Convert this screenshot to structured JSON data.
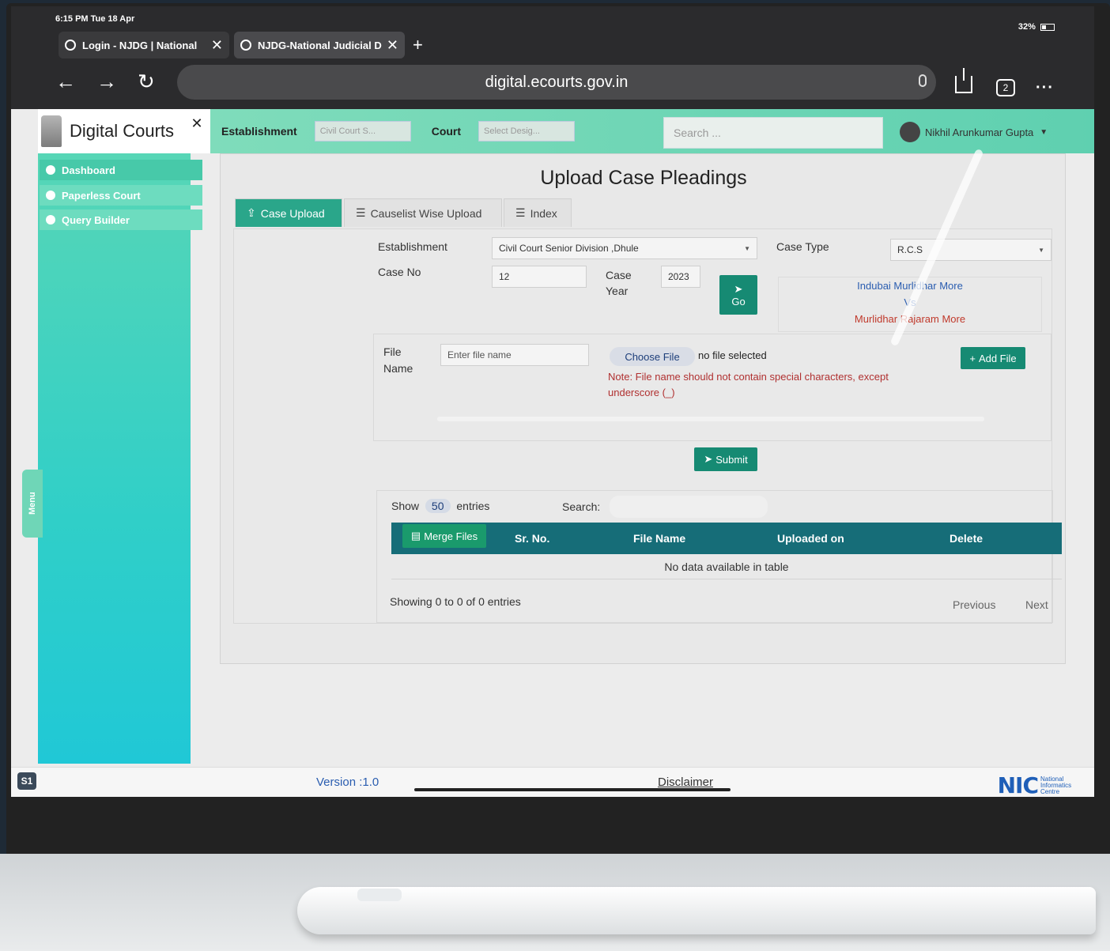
{
  "status_bar": {
    "time": "6:15 PM  Tue 18 Apr",
    "battery": "32%"
  },
  "browser": {
    "tabs": [
      {
        "label": "Login - NJDG | National"
      },
      {
        "label": "NJDG-National Judicial D"
      }
    ],
    "url": "digital.ecourts.gov.in",
    "tab_count": "2"
  },
  "app": {
    "brand": "Digital Courts",
    "header": {
      "establishment_label": "Establishment",
      "establishment_value": "Civil Court S...",
      "court_label": "Court",
      "court_value": "Select Desig...",
      "search_placeholder": "Search ...",
      "user_name": "Nikhil Arunkumar Gupta"
    },
    "sidebar": {
      "items": [
        {
          "label": "Dashboard"
        },
        {
          "label": "Paperless Court"
        },
        {
          "label": "Query Builder"
        }
      ],
      "menu_tab": "Menu"
    },
    "page_title": "Upload Case Pleadings",
    "tabs": [
      {
        "label": "Case Upload"
      },
      {
        "label": "Causelist Wise Upload"
      },
      {
        "label": "Index"
      }
    ],
    "form": {
      "establishment_label": "Establishment",
      "establishment_value": "Civil Court Senior Division ,Dhule",
      "case_type_label": "Case Type",
      "case_type_value": "R.C.S",
      "case_no_label": "Case No",
      "case_no_value": "12",
      "case_year_label": "Case Year",
      "case_year_value": "2023",
      "go_label": "Go",
      "party1": "Indubai Murlidhar More",
      "vs": "Vs",
      "party2": "Murlidhar Rajaram More",
      "file_name_label": "File Name",
      "file_name_placeholder": "Enter file name",
      "choose_file_label": "Choose File",
      "file_status": "no file selected",
      "note": "Note: File name should not contain special characters, except underscore (_)",
      "add_file_label": "Add File",
      "submit_label": "Submit"
    },
    "table": {
      "show_label": "Show",
      "show_value": "50",
      "entries_label": "entries",
      "search_label": "Search:",
      "merge_label": "Merge Files",
      "columns": [
        "Sr. No.",
        "File Name",
        "Uploaded on",
        "Delete"
      ],
      "empty_message": "No data available in table",
      "showing": "Showing 0 to 0 of 0 entries",
      "previous": "Previous",
      "next": "Next"
    },
    "footer": {
      "badge": "S1",
      "version": "Version :1.0",
      "disclaimer": "Disclaimer",
      "nic_word": "NIC",
      "nic_sub": "National Informatics Centre"
    }
  }
}
